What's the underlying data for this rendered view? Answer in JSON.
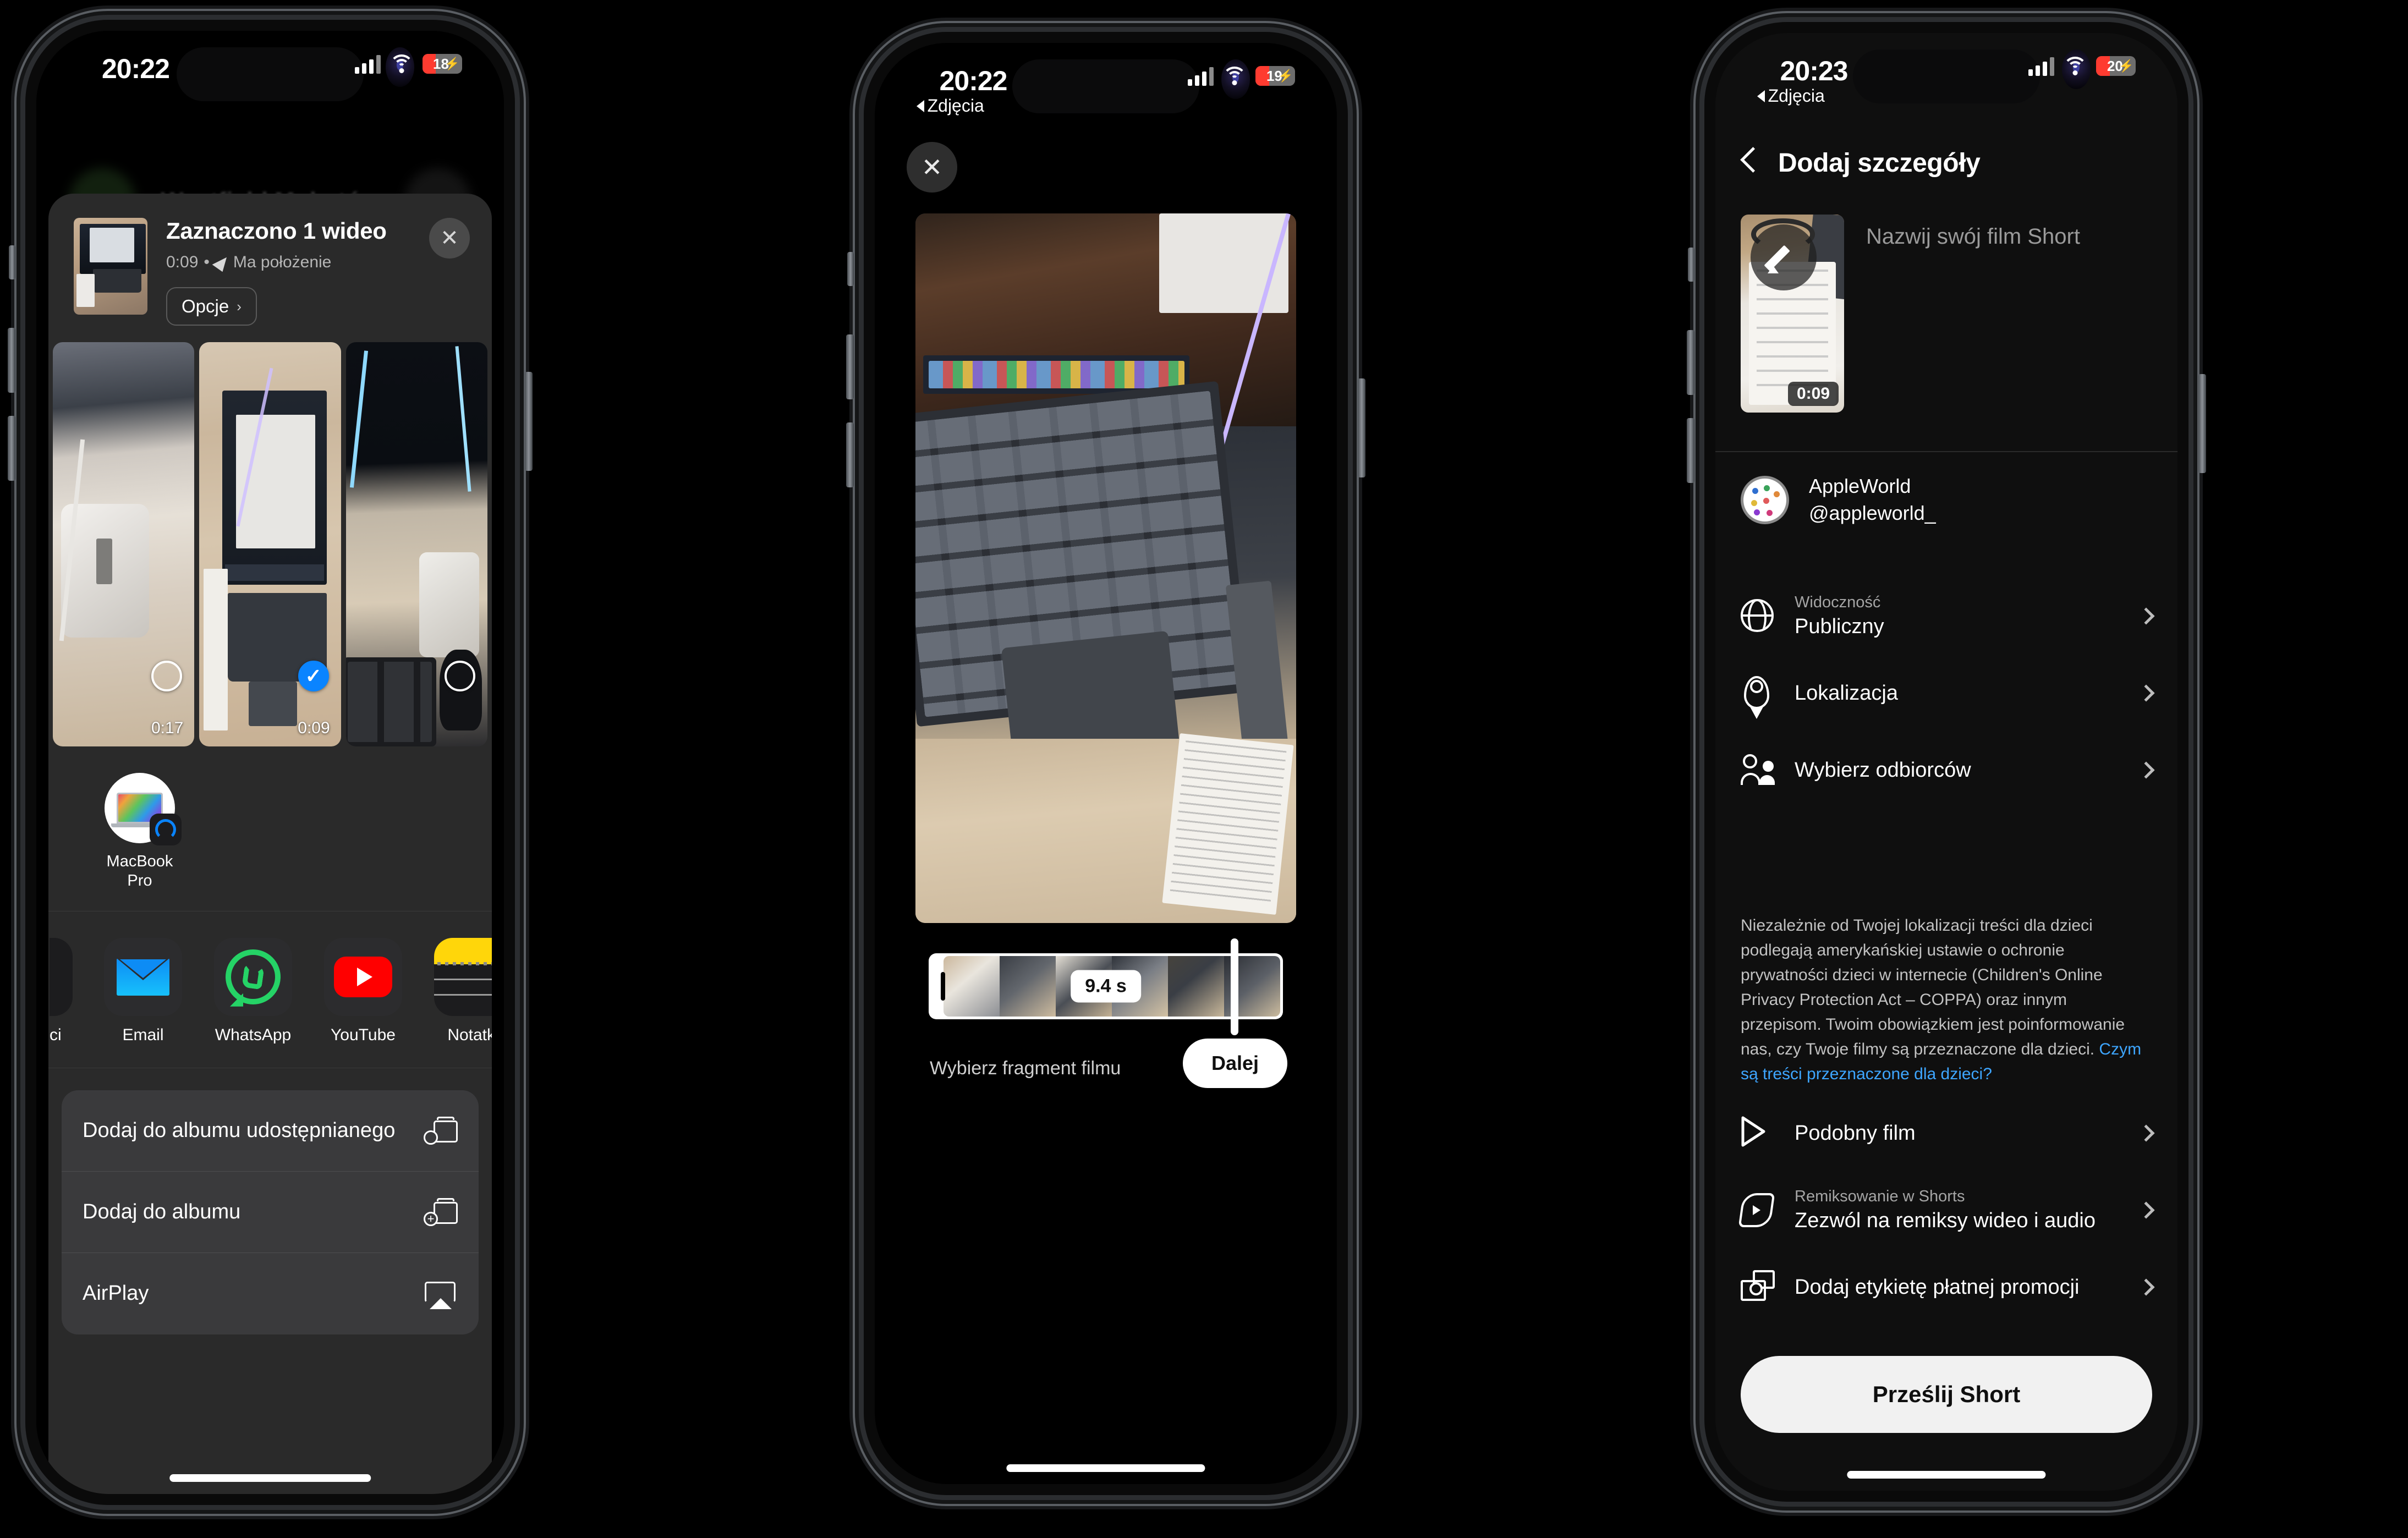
{
  "phone1": {
    "status": {
      "time": "20:22",
      "battery": "18",
      "charging": true
    },
    "background_title": "Westfield Mokotów",
    "sheet": {
      "title": "Zaznaczono 1 wideo",
      "duration": "0:09",
      "meta_separator": "•",
      "location_text": "Ma położenie",
      "options_label": "Opcje",
      "options_chevron": "›",
      "close_glyph": "✕"
    },
    "photos": [
      {
        "duration": "0:17",
        "selected": false
      },
      {
        "duration": "0:09",
        "selected": true
      },
      {
        "duration": "",
        "selected": false
      }
    ],
    "airdrop": {
      "name_line1": "MacBook",
      "name_line2": "Pro"
    },
    "apps": [
      {
        "label": "ci",
        "icon": "partial-app-icon",
        "partial": true
      },
      {
        "label": "Email",
        "icon": "mail-icon"
      },
      {
        "label": "WhatsApp",
        "icon": "whatsapp-icon"
      },
      {
        "label": "YouTube",
        "icon": "youtube-icon"
      },
      {
        "label": "Notatki",
        "icon": "notes-icon"
      }
    ],
    "actions": [
      {
        "label": "Dodaj do albumu udostępnianego",
        "icon": "shared-album-icon"
      },
      {
        "label": "Dodaj do albumu",
        "icon": "add-album-icon"
      },
      {
        "label": "AirPlay",
        "icon": "airplay-icon"
      }
    ]
  },
  "phone2": {
    "status": {
      "time": "20:22",
      "battery": "19",
      "charging": true,
      "back_label": "Zdjęcia"
    },
    "close_glyph": "✕",
    "timeline": {
      "duration_label": "9.4 s"
    },
    "hint": "Wybierz fragment filmu",
    "next_label": "Dalej"
  },
  "phone3": {
    "status": {
      "time": "20:23",
      "battery": "20",
      "charging": true,
      "back_label": "Zdjęcia"
    },
    "title": "Dodaj szczegóły",
    "title_placeholder": "Nazwij swój film Short",
    "thumb_duration": "0:09",
    "account": {
      "name": "AppleWorld",
      "handle": "@appleworld_"
    },
    "rows": [
      {
        "sub": "Widoczność",
        "main": "Publiczny",
        "icon": "globe-icon"
      },
      {
        "sub": "",
        "main": "Lokalizacja",
        "icon": "location-pin-icon"
      },
      {
        "sub": "",
        "main": "Wybierz odbiorców",
        "icon": "people-icon"
      }
    ],
    "legal": {
      "text_before_link": "Niezależnie od Twojej lokalizacji treści dla dzieci podlegają amerykańskiej ustawie o ochronie prywatności dzieci w internecie (Children's Online Privacy Protection Act – COPPA) oraz innym przepisom. Twoim obowiązkiem jest poinformowanie nas, czy Twoje filmy są przeznaczone dla dzieci. ",
      "link_text": "Czym są treści przeznaczone dla dzieci?"
    },
    "rows2": [
      {
        "sub": "",
        "main": "Podobny film",
        "icon": "play-outline-icon"
      },
      {
        "sub": "Remiksowanie w Shorts",
        "main": "Zezwól na remiksy wideo i audio",
        "icon": "remix-icon"
      },
      {
        "sub": "",
        "main": "Dodaj etykietę płatnej promocji",
        "icon": "paid-promotion-icon"
      }
    ],
    "submit_label": "Prześlij Short"
  },
  "colors": {
    "accent_blue": "#0a84ff",
    "link_blue": "#3ea6ff",
    "battery_red": "#ff3b30",
    "youtube_red": "#ff0000",
    "whatsapp_green": "#25d366",
    "notes_yellow": "#ffd60a"
  }
}
